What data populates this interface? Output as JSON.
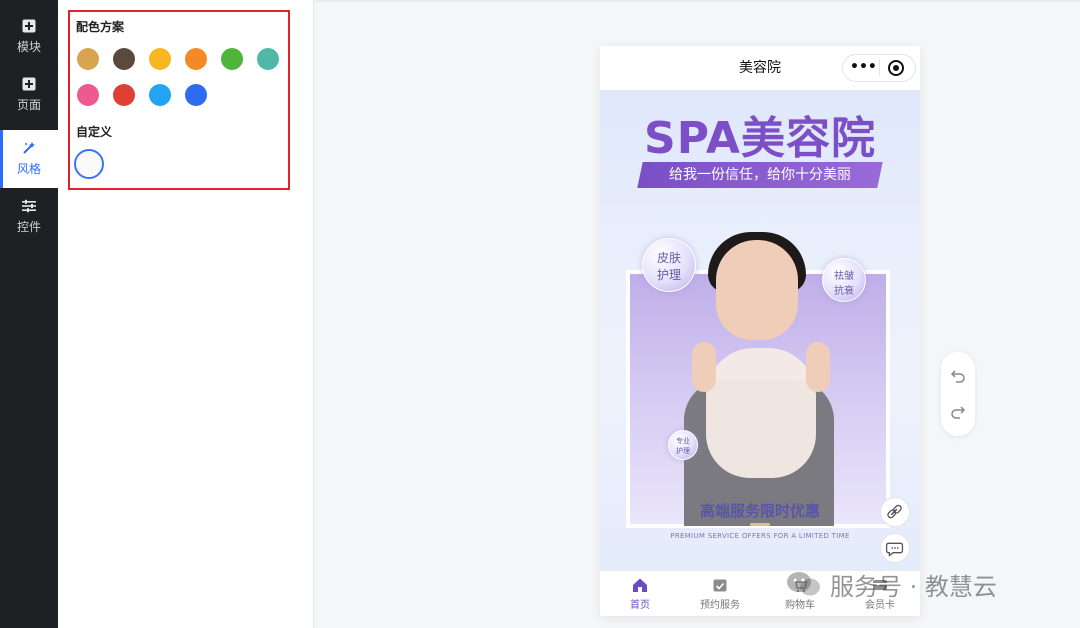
{
  "rail": {
    "items": [
      {
        "label": "模块",
        "icon": "plus-square-icon",
        "active": false
      },
      {
        "label": "页面",
        "icon": "plus-square-icon",
        "active": false
      },
      {
        "label": "风格",
        "icon": "magic-wand-icon",
        "active": true
      },
      {
        "label": "控件",
        "icon": "sliders-icon",
        "active": false
      }
    ]
  },
  "panel": {
    "scheme_title": "配色方案",
    "custom_title": "自定义",
    "swatches": [
      "#d9a451",
      "#5a4a3d",
      "#f8b620",
      "#f38a25",
      "#4fb43a",
      "#4fb8a6",
      "#ec5a90",
      "#e04033",
      "#22a4f0",
      "#2f6bf0"
    ],
    "custom_value": "#fafafa",
    "highlight_color": "#e0242c"
  },
  "phone": {
    "header_title": "美容院",
    "capsule_more": "•••",
    "banner": {
      "title": "SPA美容院",
      "ribbon": "给我一份信任，给你十分美丽",
      "bubbles": [
        {
          "lines": [
            "皮肤",
            "护理"
          ]
        },
        {
          "lines": [
            "祛皱",
            "抗衰"
          ]
        },
        {
          "lines": [
            "专业",
            "护理"
          ]
        }
      ],
      "promo_title": "高端服务限时优惠",
      "promo_sub": "PREMIUM SERVICE OFFERS FOR A LIMITED TIME"
    },
    "tabs": [
      {
        "label": "首页",
        "icon": "home-icon",
        "active": true
      },
      {
        "label": "预约服务",
        "icon": "calendar-check-icon",
        "active": false
      },
      {
        "label": "购物车",
        "icon": "cart-icon",
        "active": false
      },
      {
        "label": "会员卡",
        "icon": "card-icon",
        "active": false
      }
    ],
    "accent": "#6c4bc0"
  },
  "history": {
    "undo_icon": "undo-icon",
    "redo_icon": "redo-icon"
  },
  "watermark": {
    "text": "服务号 · 教慧云"
  }
}
